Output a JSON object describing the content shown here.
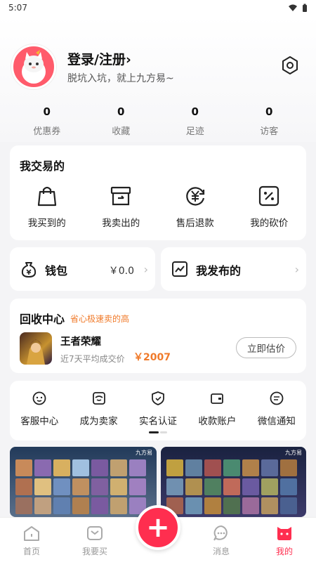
{
  "status_bar": {
    "time": "5:07"
  },
  "profile": {
    "login_label": "登录/注册›",
    "tagline": "脱坑入坑，就上九方易~"
  },
  "stats": [
    {
      "value": "0",
      "label": "优惠券"
    },
    {
      "value": "0",
      "label": "收藏"
    },
    {
      "value": "0",
      "label": "足迹"
    },
    {
      "value": "0",
      "label": "访客"
    }
  ],
  "trades": {
    "title": "我交易的",
    "items": [
      {
        "label": "我买到的",
        "icon": "shopping-bag-icon"
      },
      {
        "label": "我卖出的",
        "icon": "box-icon"
      },
      {
        "label": "售后退款",
        "icon": "yuan-refund-icon"
      },
      {
        "label": "我的砍价",
        "icon": "discount-icon"
      }
    ]
  },
  "wallet": {
    "label": "钱包",
    "value": "￥0.0",
    "icon": "wallet-icon"
  },
  "publish": {
    "label": "我发布的",
    "icon": "trend-chart-icon"
  },
  "recycle": {
    "title": "回收中心",
    "tag": "省心极速卖的高",
    "game_name": "王者荣耀",
    "avg_label": "近7天平均成交价",
    "price": "￥2007",
    "button": "立即估价"
  },
  "services": [
    {
      "label": "客服中心",
      "icon": "headset-icon"
    },
    {
      "label": "成为卖家",
      "icon": "shop-icon"
    },
    {
      "label": "实名认证",
      "icon": "shield-icon"
    },
    {
      "label": "收款账户",
      "icon": "card-icon"
    },
    {
      "label": "微信通知",
      "icon": "wechat-icon"
    }
  ],
  "banners": {
    "left_brand": "九方易",
    "right_brand": "九方易"
  },
  "tabs": [
    {
      "label": "首页",
      "icon": "home-icon"
    },
    {
      "label": "我要买",
      "icon": "gamepad-icon"
    },
    {
      "label": "消息",
      "icon": "chat-icon"
    },
    {
      "label": "我的",
      "icon": "cat-face-icon"
    }
  ],
  "fab": {
    "label": "+"
  },
  "colors": {
    "accent": "#ff2e4f",
    "orange": "#f07a2a"
  }
}
